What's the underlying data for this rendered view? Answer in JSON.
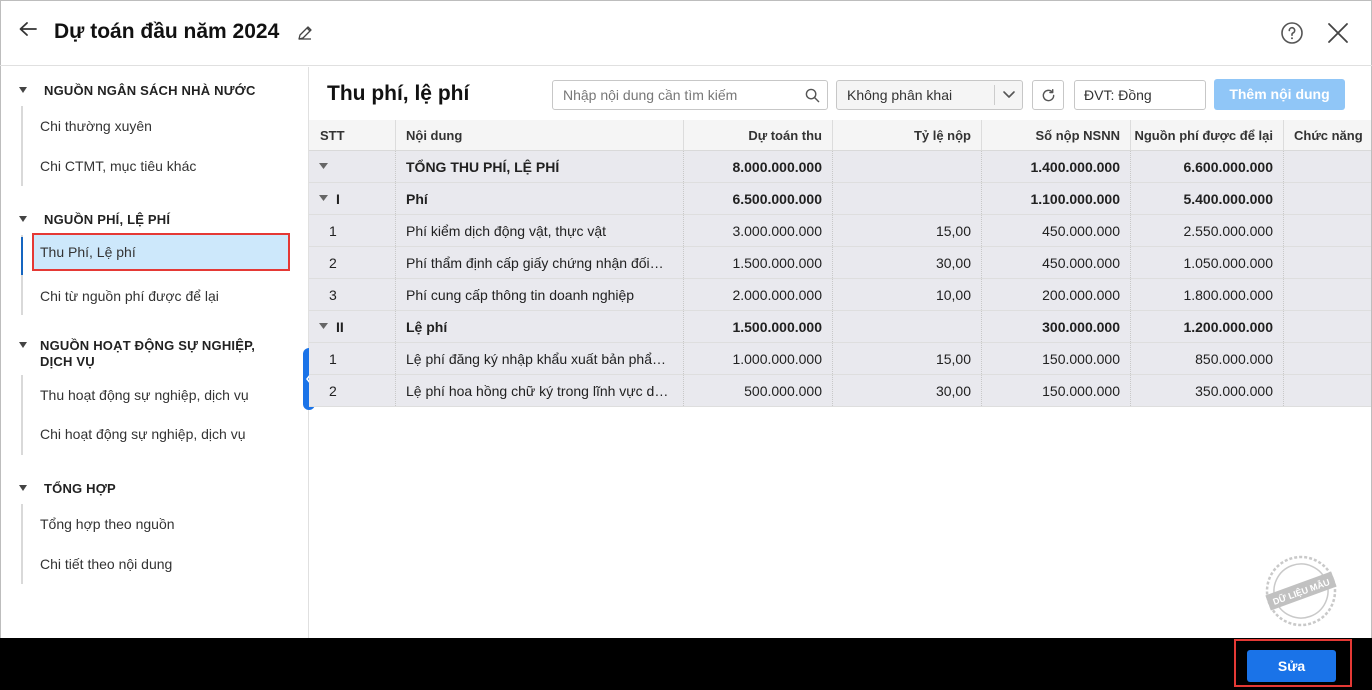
{
  "header": {
    "title": "Dự toán đầu năm 2024"
  },
  "sidebar": {
    "groups": [
      {
        "title": "NGUỒN NGÂN SÁCH NHÀ NƯỚC",
        "items": [
          "Chi thường xuyên",
          "Chi CTMT, mục tiêu khác"
        ]
      },
      {
        "title": "NGUỒN PHÍ, LỆ PHÍ",
        "items": [
          "Thu Phí, Lệ phí",
          "Chi từ nguồn phí được để lại"
        ]
      },
      {
        "title_line1": "NGUỒN HOẠT ĐỘNG SỰ NGHIỆP,",
        "title_line2": "DỊCH VỤ",
        "items": [
          "Thu hoạt động sự nghiệp, dịch vụ",
          "Chi hoạt động sự nghiệp, dịch vụ"
        ]
      },
      {
        "title": "TỔNG HỢP",
        "items": [
          "Tổng hợp theo nguồn",
          "Chi tiết theo nội dung"
        ]
      }
    ],
    "active_item": "Thu Phí, Lệ phí"
  },
  "main": {
    "title": "Thu phí, lệ phí",
    "search_placeholder": "Nhập nội dung cần tìm kiếm",
    "select_value": "Không phân khai",
    "unit": "ĐVT: Đồng",
    "add_button": "Thêm nội dung"
  },
  "table": {
    "columns": [
      "STT",
      "Nội dung",
      "Dự toán thu",
      "Tỷ lệ nộp",
      "Số nộp NSNN",
      "Nguồn phí được để lại",
      "Chức năng"
    ],
    "rows": [
      {
        "stt": "",
        "content": "TỔNG THU PHÍ, LỆ PHÍ",
        "du_toan": "8.000.000.000",
        "ty_le": "",
        "so_nop": "1.400.000.000",
        "nguon_phi": "6.600.000.000"
      },
      {
        "stt": "I",
        "content": "Phí",
        "du_toan": "6.500.000.000",
        "ty_le": "",
        "so_nop": "1.100.000.000",
        "nguon_phi": "5.400.000.000"
      },
      {
        "stt": "1",
        "content": "Phí kiểm dịch động vật, thực vật",
        "du_toan": "3.000.000.000",
        "ty_le": "15,00",
        "so_nop": "450.000.000",
        "nguon_phi": "2.550.000.000"
      },
      {
        "stt": "2",
        "content": "Phí thẩm định cấp giấy chứng nhận đối…",
        "du_toan": "1.500.000.000",
        "ty_le": "30,00",
        "so_nop": "450.000.000",
        "nguon_phi": "1.050.000.000"
      },
      {
        "stt": "3",
        "content": "Phí cung cấp thông tin doanh nghiệp",
        "du_toan": "2.000.000.000",
        "ty_le": "10,00",
        "so_nop": "200.000.000",
        "nguon_phi": "1.800.000.000"
      },
      {
        "stt": "II",
        "content": "Lệ phí",
        "du_toan": "1.500.000.000",
        "ty_le": "",
        "so_nop": "300.000.000",
        "nguon_phi": "1.200.000.000"
      },
      {
        "stt": "1",
        "content": "Lệ phí đăng ký nhập khẩu xuất bản phẩm…",
        "du_toan": "1.000.000.000",
        "ty_le": "15,00",
        "so_nop": "150.000.000",
        "nguon_phi": "850.000.000"
      },
      {
        "stt": "2",
        "content": "Lệ phí hoa hồng chữ ký trong lĩnh vực dầ…",
        "du_toan": "500.000.000",
        "ty_le": "30,00",
        "so_nop": "150.000.000",
        "nguon_phi": "350.000.000"
      }
    ]
  },
  "footer": {
    "save_label": "Sửa"
  },
  "watermark": {
    "text": "DỮ LIỆU MẪU"
  },
  "colors": {
    "primary": "#1a73e8",
    "highlight": "#e53935",
    "active_bg": "#cde8fb"
  }
}
